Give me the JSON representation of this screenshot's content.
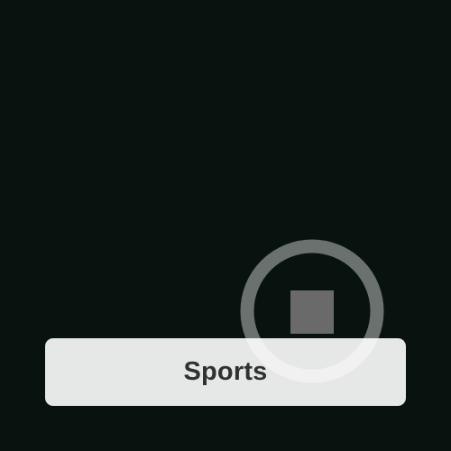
{
  "category_button": {
    "label": "Sports"
  },
  "stop_control": {
    "icon": "stop-icon"
  },
  "colors": {
    "background": "#08130f",
    "button_background": "#e6e8e7",
    "button_text": "#2f3231",
    "stop_ring": "rgba(255,255,255,0.40)",
    "stop_square": "#6a6a6a"
  }
}
